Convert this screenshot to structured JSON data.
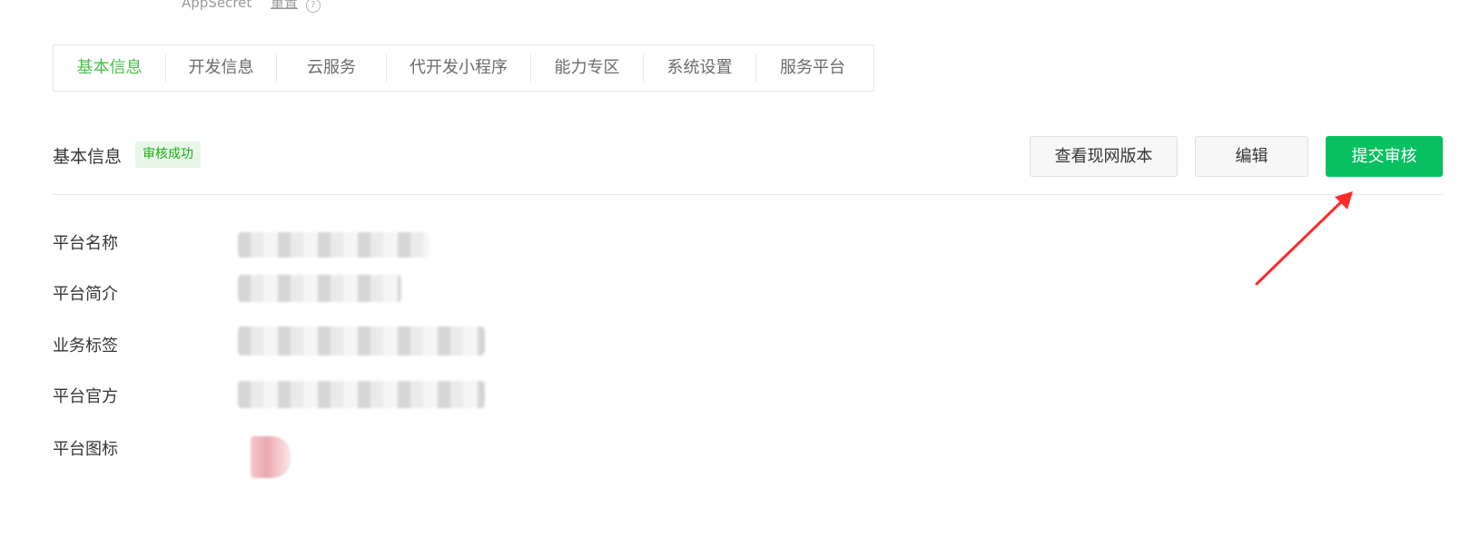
{
  "top_cut": {
    "label": "AppSecret",
    "link": "重置"
  },
  "tabs": [
    {
      "label": "基本信息",
      "active": true
    },
    {
      "label": "开发信息",
      "active": false
    },
    {
      "label": "云服务",
      "active": false
    },
    {
      "label": "代开发小程序",
      "active": false
    },
    {
      "label": "能力专区",
      "active": false
    },
    {
      "label": "系统设置",
      "active": false
    },
    {
      "label": "服务平台",
      "active": false
    }
  ],
  "section": {
    "title": "基本信息",
    "status_badge": "审核成功",
    "buttons": {
      "view_live": "查看现网版本",
      "edit": "编辑",
      "submit_review": "提交审核"
    }
  },
  "fields": [
    {
      "label": "平台名称"
    },
    {
      "label": "平台简介"
    },
    {
      "label": "业务标签"
    },
    {
      "label": "平台官方"
    },
    {
      "label": "平台图标"
    }
  ],
  "colors": {
    "accent_green": "#07c160",
    "active_tab_green": "#4bbf4b",
    "annotation_red": "#ff2a2a"
  }
}
